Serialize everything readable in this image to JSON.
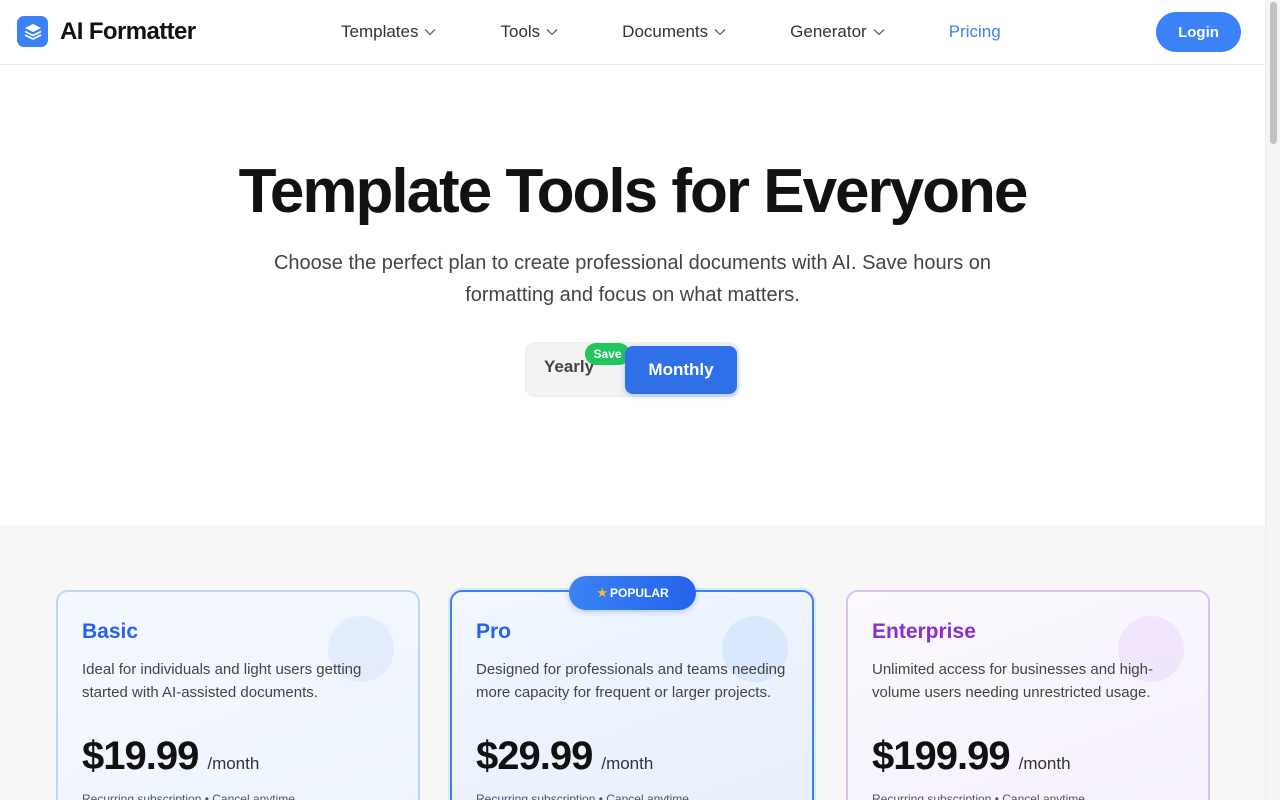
{
  "brand": {
    "name": "AI Formatter",
    "icon": "layers-icon"
  },
  "nav": {
    "items": [
      {
        "label": "Templates",
        "has_dropdown": true
      },
      {
        "label": "Tools",
        "has_dropdown": true
      },
      {
        "label": "Documents",
        "has_dropdown": true
      },
      {
        "label": "Generator",
        "has_dropdown": true
      },
      {
        "label": "Pricing",
        "has_dropdown": false,
        "active": true
      }
    ],
    "login_label": "Login"
  },
  "hero": {
    "title": "Template Tools for Everyone",
    "subtitle": "Choose the perfect plan to create professional documents with AI. Save hours on formatting and focus on what matters."
  },
  "billing_toggle": {
    "yearly_label": "Yearly",
    "monthly_label": "Monthly",
    "save_badge": "Save",
    "selected": "Monthly"
  },
  "plans": [
    {
      "name": "Basic",
      "description": "Ideal for individuals and light users getting started with AI-assisted documents.",
      "price": "$19.99",
      "period": "/month",
      "billing_note": "Recurring subscription • Cancel anytime"
    },
    {
      "name": "Pro",
      "badge": "POPULAR",
      "description": "Designed for professionals and teams needing more capacity for frequent or larger projects.",
      "price": "$29.99",
      "period": "/month",
      "billing_note": "Recurring subscription • Cancel anytime"
    },
    {
      "name": "Enterprise",
      "description": "Unlimited access for businesses and high-volume users needing unrestricted usage.",
      "price": "$199.99",
      "period": "/month",
      "billing_note": "Recurring subscription • Cancel anytime"
    }
  ],
  "colors": {
    "accent": "#3b82f6",
    "toggle_active": "#2f6fe8",
    "save_badge": "#22c55e",
    "enterprise": "#8b2fc9"
  }
}
